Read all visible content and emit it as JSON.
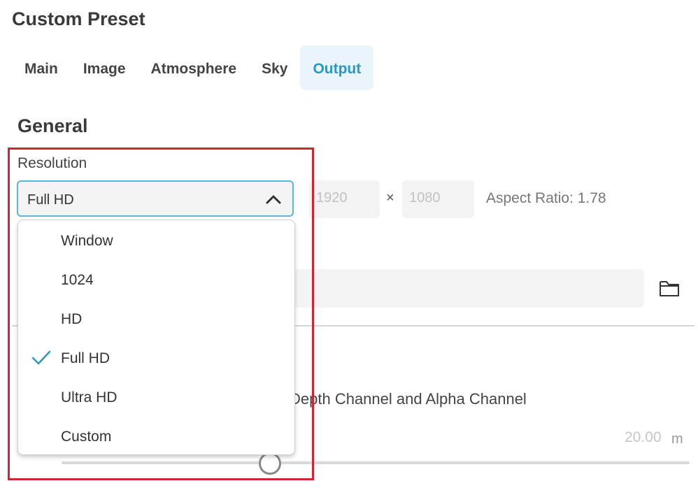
{
  "header": {
    "title": "Custom Preset"
  },
  "tabs": [
    {
      "label": "Main"
    },
    {
      "label": "Image"
    },
    {
      "label": "Atmosphere"
    },
    {
      "label": "Sky"
    },
    {
      "label": "Output",
      "active": true
    }
  ],
  "general": {
    "title": "General",
    "resolution": {
      "label": "Resolution",
      "selected": "Full HD",
      "width": "1920",
      "times": "×",
      "height": "1080",
      "aspect_ratio": "Aspect Ratio: 1.78",
      "options": [
        "Window",
        "1024",
        "HD",
        "Full HD",
        "Ultra HD",
        "Custom"
      ]
    },
    "depth_alpha_label": "Depth Channel and Alpha Channel",
    "distance": {
      "value": "20.00",
      "unit": "m"
    }
  },
  "colors": {
    "accent": "#2799c2",
    "highlight": "#d6232f"
  }
}
